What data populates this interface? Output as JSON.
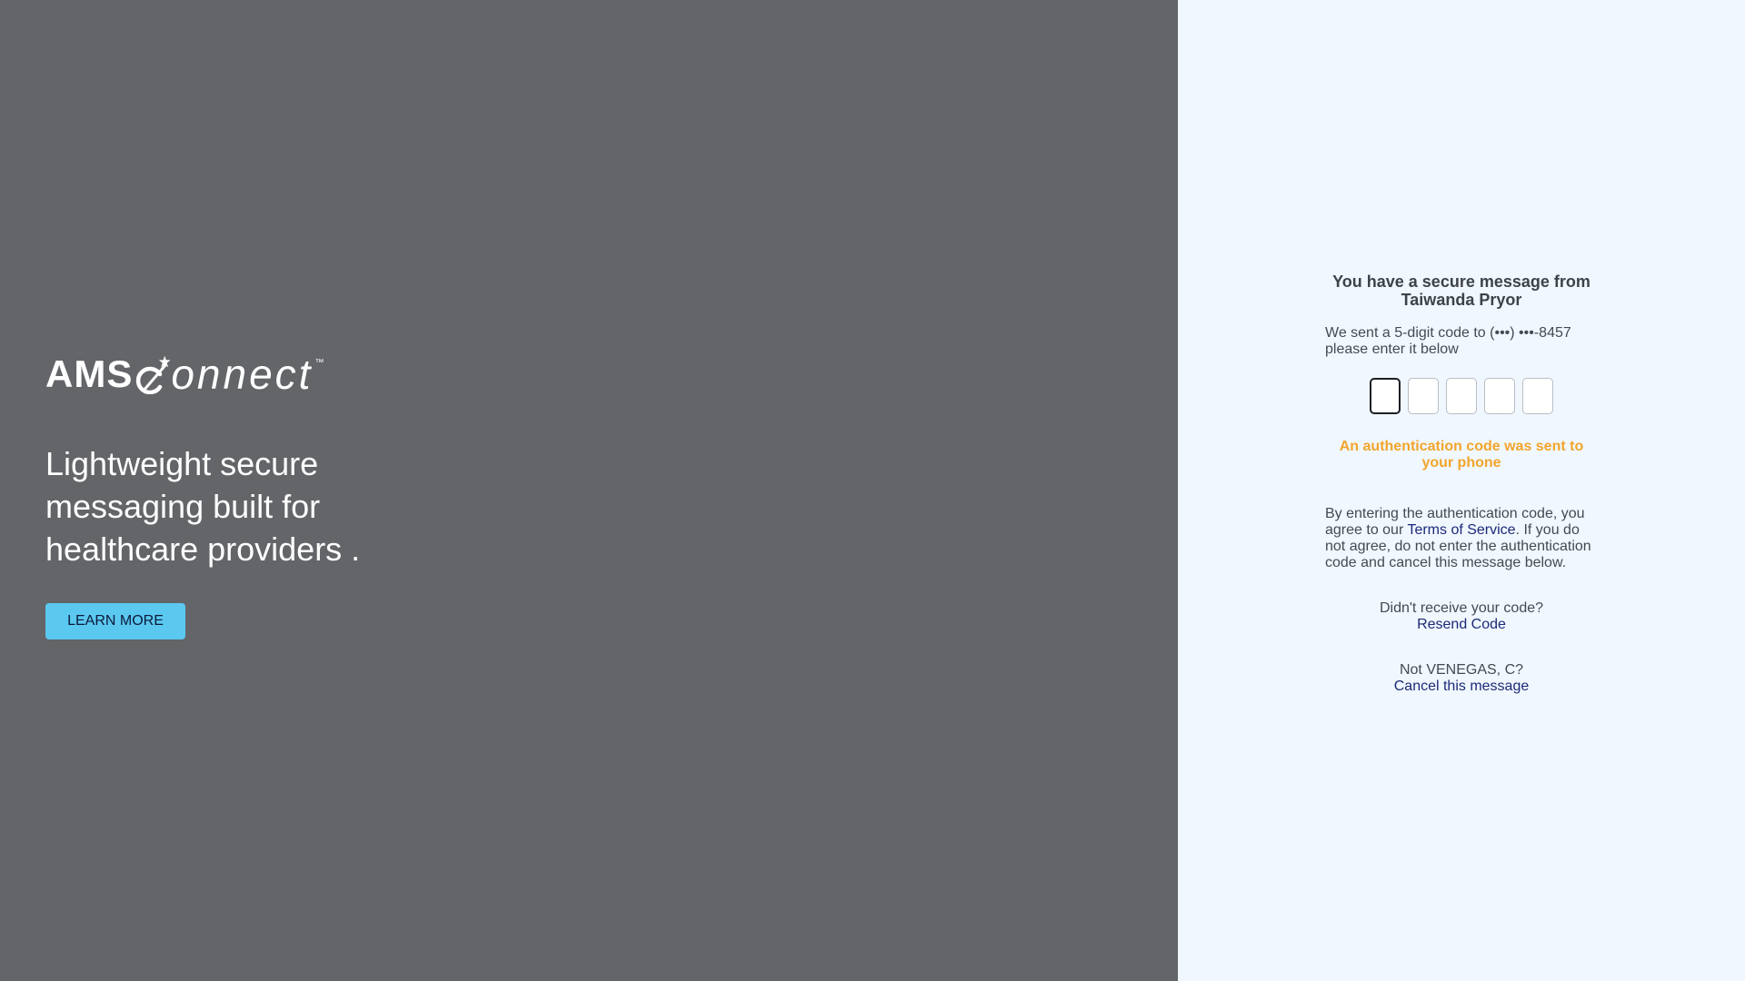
{
  "brand": {
    "ams": "AMS",
    "onnect": "onnect",
    "tm": "™"
  },
  "hero": {
    "tagline": "Lightweight secure messaging built for healthcare providers .",
    "learn_more_label": "LEARN MORE"
  },
  "auth": {
    "heading": "You have a secure message from Taiwanda Pryor",
    "sent_text": "We sent a 5-digit code to (•••) •••-8457 please enter it below",
    "code_digits": [
      "",
      "",
      "",
      "",
      ""
    ],
    "notice": "An authentication code was sent to your phone",
    "terms_prefix": "By entering the authentication code, you agree to our ",
    "terms_link": "Terms of Service",
    "terms_suffix": ". If you do not agree, do not enter the authentication code and cancel this message below.",
    "resend_prompt": "Didn't receive your code?",
    "resend_link": "Resend Code",
    "not_user_prompt": "Not VENEGAS, C?",
    "cancel_link": "Cancel this message"
  },
  "colors": {
    "left_bg": "#636569",
    "right_bg": "#f0f7fe",
    "button_bg": "#5bc8f0",
    "notice": "#f2a52c",
    "link": "#1c2a78"
  }
}
